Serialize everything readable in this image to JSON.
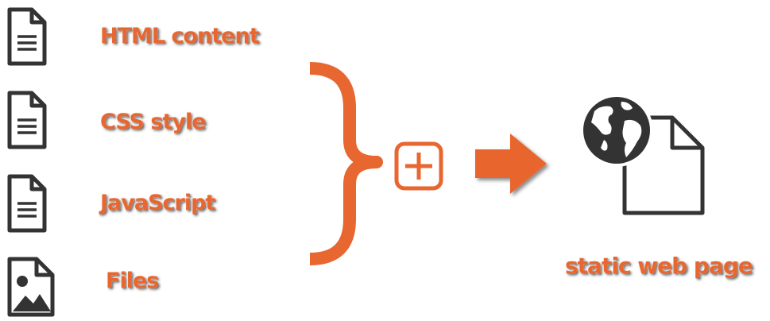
{
  "inputs": [
    {
      "label": "HTML content",
      "icon": "document-icon"
    },
    {
      "label": "CSS style",
      "icon": "document-icon"
    },
    {
      "label": "JavaScript",
      "icon": "document-icon"
    },
    {
      "label": "Files",
      "icon": "image-file-icon"
    }
  ],
  "output": {
    "label": "static web page",
    "icon": "web-page-globe-icon"
  },
  "colors": {
    "accent": "#e8662f",
    "icon_stroke": "#333333",
    "text_fill": "#e8662f"
  },
  "symbols": {
    "brace": "right-curly-brace",
    "plus": "plus-box-icon",
    "arrow": "right-arrow-icon"
  }
}
